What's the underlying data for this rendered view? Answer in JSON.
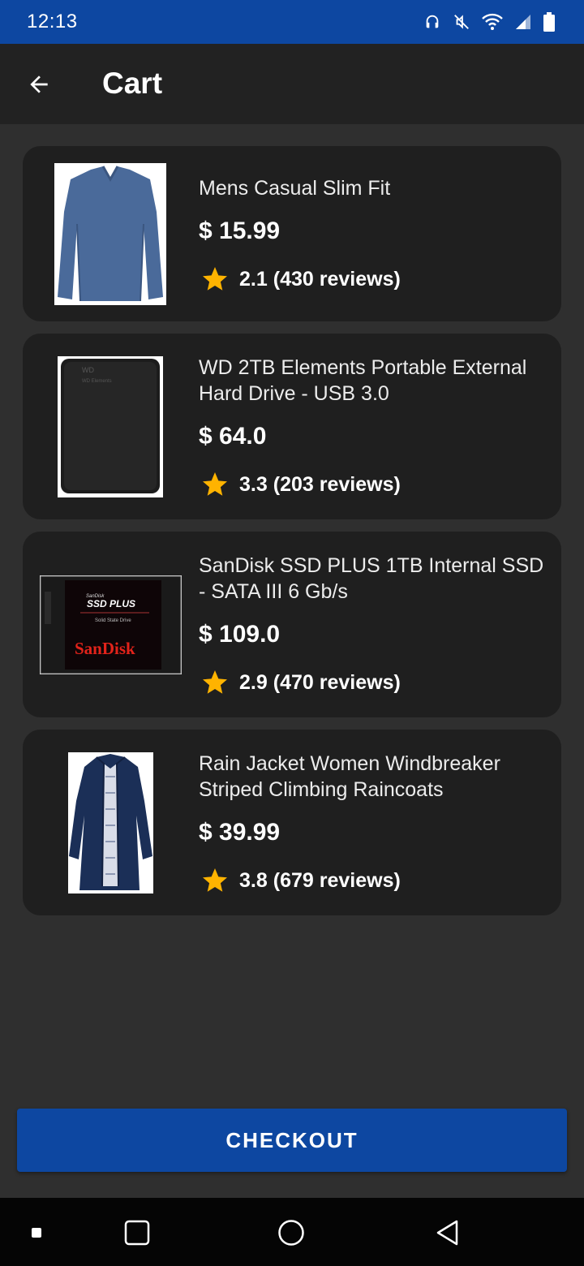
{
  "status_bar": {
    "time": "12:13",
    "icons": [
      "headset-icon",
      "mute-icon",
      "wifi-icon",
      "signal-icon",
      "battery-icon"
    ]
  },
  "app_bar": {
    "title": "Cart",
    "back_icon": "arrow-back-icon"
  },
  "cart": {
    "items": [
      {
        "name": "Mens Casual Slim Fit",
        "price": "$ 15.99",
        "rating": "2.1",
        "reviews": "(430 reviews)",
        "image": "long-sleeve-shirt"
      },
      {
        "name": "WD 2TB Elements Portable External Hard Drive - USB 3.0",
        "price": "$ 64.0",
        "rating": "3.3",
        "reviews": "(203 reviews)",
        "image": "external-hard-drive"
      },
      {
        "name": "SanDisk SSD PLUS 1TB Internal SSD - SATA III 6 Gb/s",
        "price": "$ 109.0",
        "rating": "2.9",
        "reviews": "(470 reviews)",
        "image": "ssd-drive"
      },
      {
        "name": "Rain Jacket Women Windbreaker Striped Climbing Raincoats",
        "price": "$ 39.99",
        "rating": "3.8",
        "reviews": "(679 reviews)",
        "image": "rain-jacket"
      }
    ]
  },
  "product_image_text": {
    "wd_brand": "WD",
    "wd_model": "WD Elements",
    "ssd_brand_small": "SanDisk",
    "ssd_title": "SSD PLUS",
    "ssd_subtitle": "Solid State Drive",
    "ssd_logo": "SanDisk"
  },
  "checkout": {
    "label": "CHECKOUT"
  },
  "nav_bar": {
    "icons": [
      "recent-square-icon",
      "overview-square-icon",
      "home-circle-icon",
      "back-triangle-icon"
    ]
  },
  "colors": {
    "primary": "#0d47a1",
    "background": "#2f2f2f",
    "card": "#1f1f1f",
    "app_bar": "#222222",
    "star": "#ffb300"
  }
}
